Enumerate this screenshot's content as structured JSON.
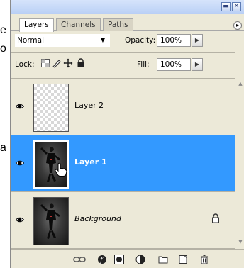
{
  "background_fragments": [
    "e",
    "o",
    "a"
  ],
  "tabs": [
    {
      "label": "Layers",
      "active": true
    },
    {
      "label": "Channels",
      "active": false
    },
    {
      "label": "Paths",
      "active": false
    }
  ],
  "blend_mode": {
    "value": "Normal"
  },
  "opacity": {
    "label": "Opacity:",
    "value": "100%"
  },
  "lock": {
    "label": "Lock:"
  },
  "fill": {
    "label": "Fill:",
    "value": "100%"
  },
  "layers": [
    {
      "name": "Layer 2",
      "visible": true,
      "selected": false,
      "thumb": "transparent"
    },
    {
      "name": "Layer 1",
      "visible": true,
      "selected": true,
      "thumb": "photo"
    },
    {
      "name": "Background",
      "visible": true,
      "selected": false,
      "thumb": "photo",
      "locked": true
    }
  ],
  "colors": {
    "selection": "#3399ff",
    "panel": "#ece9d8",
    "titlebar": "#c7d9f8"
  },
  "footer_icons": [
    "link-layers-icon",
    "layer-style-icon",
    "layer-mask-icon",
    "adjustment-layer-icon",
    "new-group-icon",
    "new-layer-icon",
    "delete-layer-icon"
  ]
}
